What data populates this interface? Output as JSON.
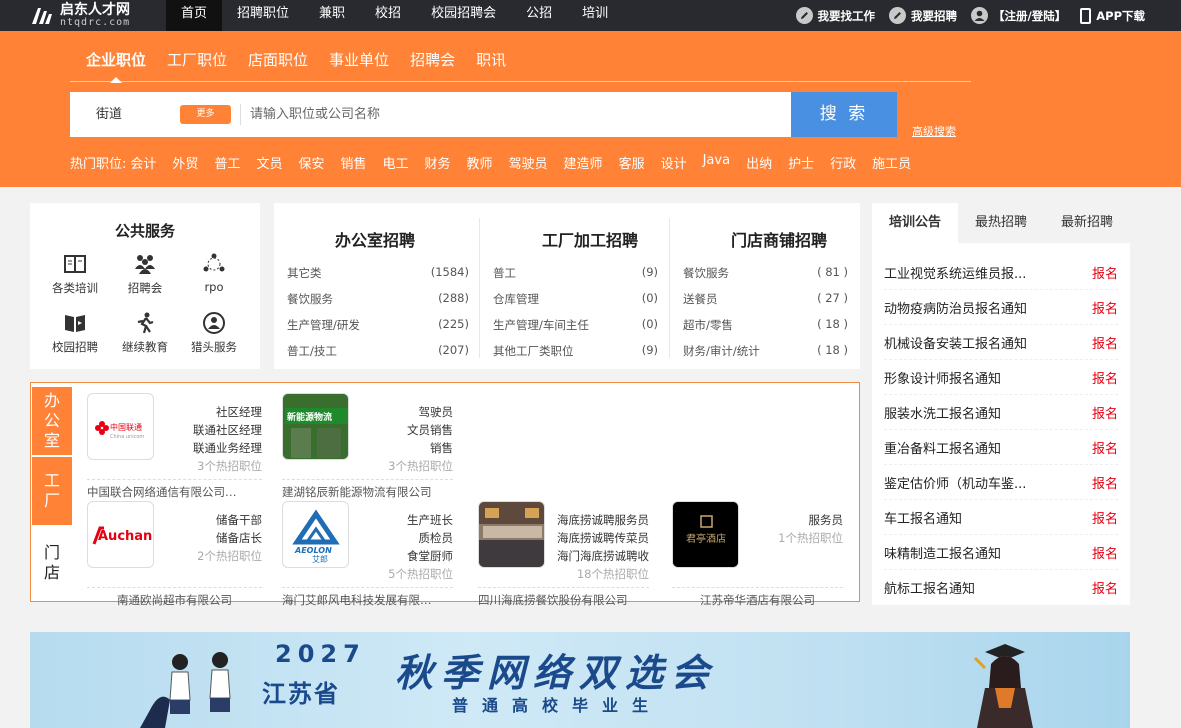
{
  "topbar": {
    "logo_text": "启东人才网",
    "logo_url": "ntqdrc.com",
    "nav": [
      "首页",
      "招聘职位",
      "兼职",
      "校招",
      "校园招聘会",
      "公招",
      "培训"
    ],
    "links": {
      "find_job": "我要找工作",
      "post_job": "我要招聘",
      "login": "【注册/登陆】",
      "app": "APP下载"
    }
  },
  "search": {
    "tabs": [
      "企业职位",
      "工厂职位",
      "店面职位",
      "事业单位",
      "招聘会",
      "职讯"
    ],
    "area": "街道",
    "more": "更多",
    "placeholder": "请输入职位或公司名称",
    "button": "搜 索",
    "advanced": "高级搜索",
    "hot_label": "热门职位:",
    "hot": [
      "会计",
      "外贸",
      "普工",
      "文员",
      "保安",
      "销售",
      "电工",
      "财务",
      "教师",
      "驾驶员",
      "建造师",
      "客服",
      "设计",
      "Java",
      "出纳",
      "护士",
      "行政",
      "施工员"
    ]
  },
  "services": {
    "title": "公共服务",
    "items": [
      {
        "label": "各类培训",
        "icon": "book-icon"
      },
      {
        "label": "招聘会",
        "icon": "people-icon"
      },
      {
        "label": "rpo",
        "icon": "network-icon"
      },
      {
        "label": "校园招聘",
        "icon": "open-book-icon"
      },
      {
        "label": "继续教育",
        "icon": "runner-icon"
      },
      {
        "label": "猎头服务",
        "icon": "headhunter-icon"
      }
    ]
  },
  "job_categories": [
    {
      "title": "办公室招聘",
      "rows": [
        [
          "其它类",
          "(1584)"
        ],
        [
          "餐饮服务",
          "(288)"
        ],
        [
          "生产管理/研发",
          "(225)"
        ],
        [
          "普工/技工",
          "(207)"
        ]
      ]
    },
    {
      "title": "工厂加工招聘",
      "rows": [
        [
          "普工",
          "(9)"
        ],
        [
          "仓库管理",
          "(0)"
        ],
        [
          "生产管理/车间主任",
          "(0)"
        ],
        [
          "其他工厂类职位",
          "(9)"
        ]
      ]
    },
    {
      "title": "门店商铺招聘",
      "rows": [
        [
          "餐饮服务",
          "( 81 )"
        ],
        [
          "送餐员",
          "( 27 )"
        ],
        [
          "超市/零售",
          "( 18 )"
        ],
        [
          "财务/审计/统计",
          "( 18 )"
        ]
      ]
    }
  ],
  "featured": {
    "tabs": [
      "办公室",
      "工厂",
      "门店"
    ],
    "companies": [
      {
        "name": "中国联合网络通信有限公司…",
        "jobs": [
          "社区经理",
          "联通社区经理",
          "联通业务经理"
        ],
        "count": "3个热招职位",
        "logo_text": "中国联通",
        "logo_sub": "China unicom"
      },
      {
        "name": "建湖铭辰新能源物流有限公司",
        "jobs": [
          "驾驶员",
          "文员销售",
          "销售"
        ],
        "count": "3个热招职位",
        "logo_text": "新能源物流"
      },
      {
        "name": "南通欧尚超市有限公司",
        "jobs": [
          "储备干部",
          "储备店长"
        ],
        "count": "2个热招职位",
        "logo_text": "Auchan"
      },
      {
        "name": "海门艾郎风电科技发展有限…",
        "jobs": [
          "生产班长",
          "质检员",
          "食堂厨师"
        ],
        "count": "5个热招职位",
        "logo_text": "AEOLON",
        "logo_sub": "艾郎"
      },
      {
        "name": "四川海底捞餐饮股份有限公司",
        "jobs": [
          "海底捞诚聘服务员",
          "海底捞诚聘传菜员",
          "海门海底捞诚聘收"
        ],
        "count": "18个热招职位"
      },
      {
        "name": "江苏帝华酒店有限公司",
        "jobs": [
          "服务员"
        ],
        "count": "1个热招职位",
        "logo_text": "君亭酒店"
      }
    ]
  },
  "notices": {
    "tabs": [
      "培训公告",
      "最热招聘",
      "最新招聘"
    ],
    "tag": "报名",
    "items": [
      "工业视觉系统运维员报...",
      "动物疫病防治员报名通知",
      "机械设备安装工报名通知",
      "形象设计师报名通知",
      "服装水洗工报名通知",
      "重冶备料工报名通知",
      "鉴定估价师（机动车鉴...",
      "车工报名通知",
      "味精制造工报名通知",
      "航标工报名通知"
    ]
  },
  "banner": {
    "year": "2027",
    "province": "江苏省",
    "title": "秋季网络双选会",
    "subtitle": "普通高校毕业生"
  },
  "colors": {
    "orange": "#ff8236",
    "topbar": "#282a30",
    "blue": "#4a90e2",
    "red": "#e60012"
  }
}
